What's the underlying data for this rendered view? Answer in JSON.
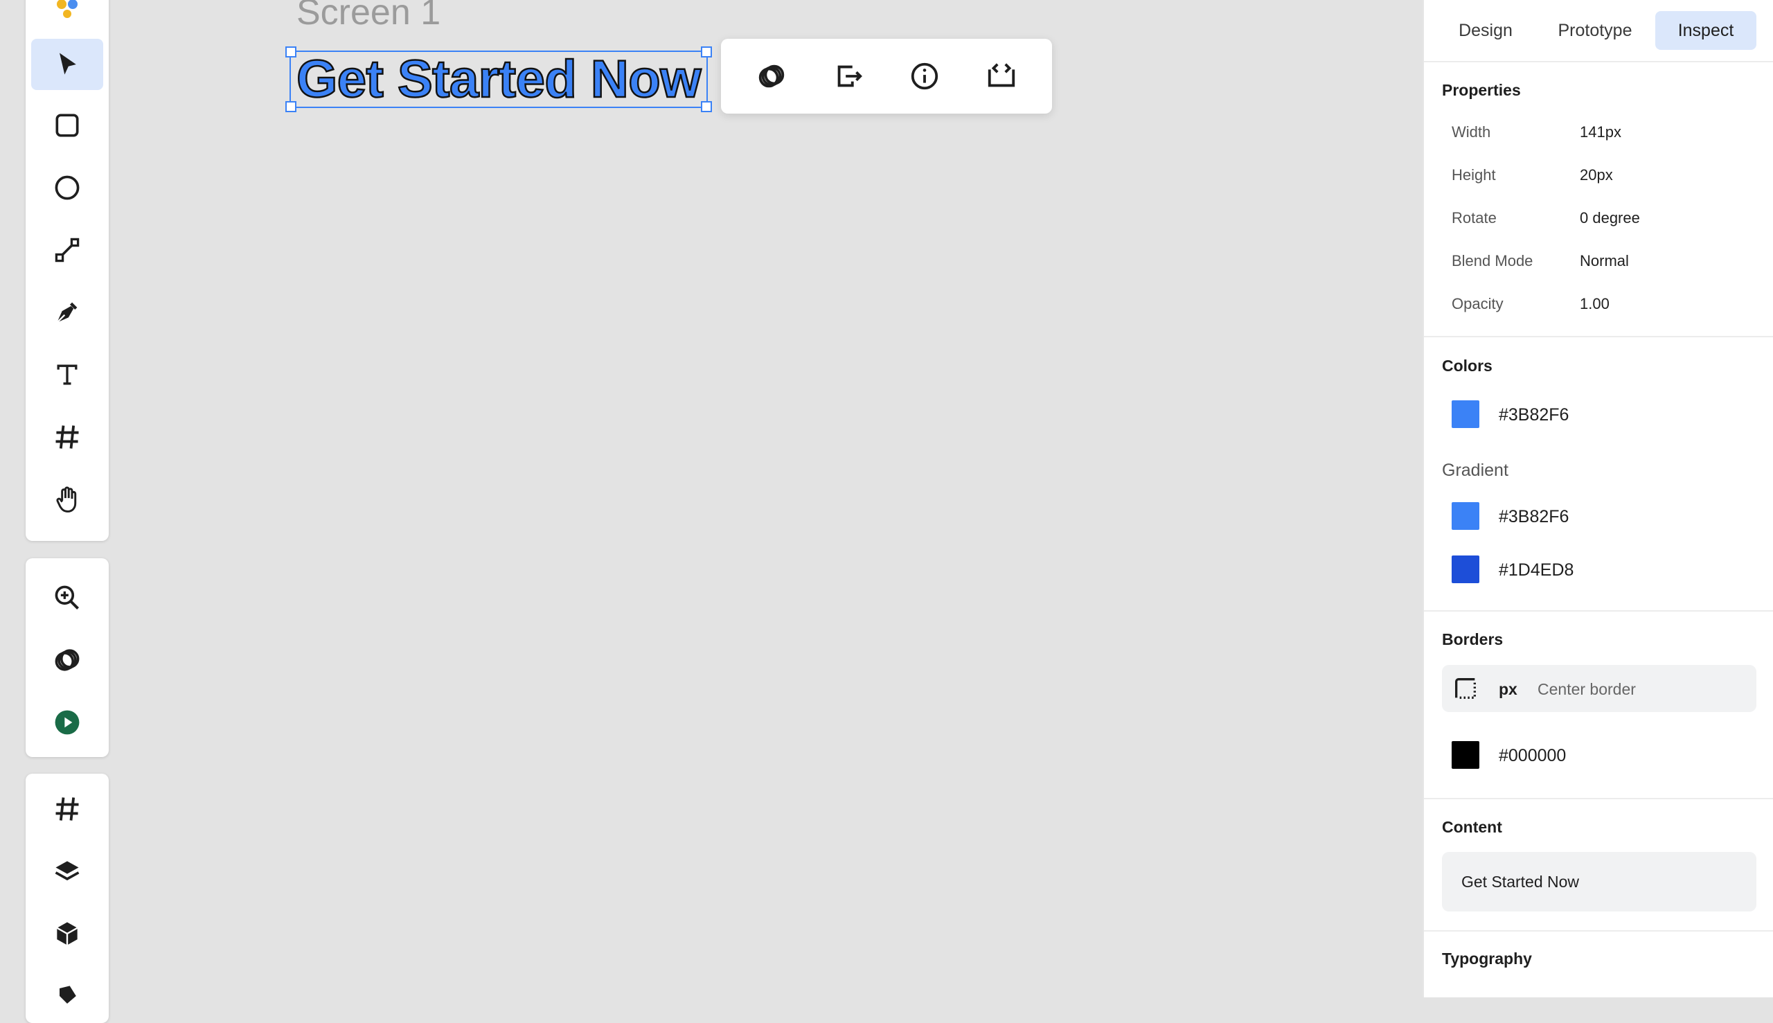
{
  "canvas": {
    "frame_label": "Screen 1",
    "selected_text": "Get Started Now"
  },
  "toolbar": {
    "tools": [
      {
        "name": "move",
        "icon": "cursor-arrow-icon",
        "active": true
      },
      {
        "name": "rectangle",
        "icon": "rounded-square-icon"
      },
      {
        "name": "ellipse",
        "icon": "circle-icon"
      },
      {
        "name": "line",
        "icon": "line-icon"
      },
      {
        "name": "pen",
        "icon": "pen-nib-icon"
      },
      {
        "name": "text",
        "icon": "text-t-icon"
      },
      {
        "name": "frame",
        "icon": "hash-icon"
      },
      {
        "name": "hand",
        "icon": "hand-icon"
      }
    ],
    "misc_tools": [
      {
        "name": "zoom",
        "icon": "zoom-in-icon"
      },
      {
        "name": "link",
        "icon": "chain-link-icon"
      },
      {
        "name": "present",
        "icon": "play-circle-icon"
      }
    ],
    "layer_tools": [
      {
        "name": "frames",
        "icon": "hash-icon"
      },
      {
        "name": "layers",
        "icon": "layers-icon"
      },
      {
        "name": "components",
        "icon": "cube-icon"
      },
      {
        "name": "more",
        "icon": "tag-icon"
      }
    ]
  },
  "floating_toolbar": [
    {
      "name": "link",
      "icon": "chain-link-icon"
    },
    {
      "name": "export",
      "icon": "export-icon"
    },
    {
      "name": "info",
      "icon": "info-icon"
    },
    {
      "name": "code",
      "icon": "code-icon"
    }
  ],
  "inspector": {
    "tabs": [
      "Design",
      "Prototype",
      "Inspect"
    ],
    "active_tab": "Inspect",
    "properties": {
      "title": "Properties",
      "rows": [
        {
          "label": "Width",
          "value": "141px"
        },
        {
          "label": "Height",
          "value": "20px"
        },
        {
          "label": "Rotate",
          "value": "0 degree"
        },
        {
          "label": "Blend Mode",
          "value": "Normal"
        },
        {
          "label": "Opacity",
          "value": "1.00"
        }
      ]
    },
    "colors": {
      "title": "Colors",
      "fill": "#3B82F6",
      "gradient_label": "Gradient",
      "gradient": [
        "#3B82F6",
        "#1D4ED8"
      ]
    },
    "borders": {
      "title": "Borders",
      "unit": "px",
      "position": "Center border",
      "color": "#000000"
    },
    "content": {
      "title": "Content",
      "text": "Get Started Now"
    },
    "typography": {
      "title": "Typography"
    }
  }
}
